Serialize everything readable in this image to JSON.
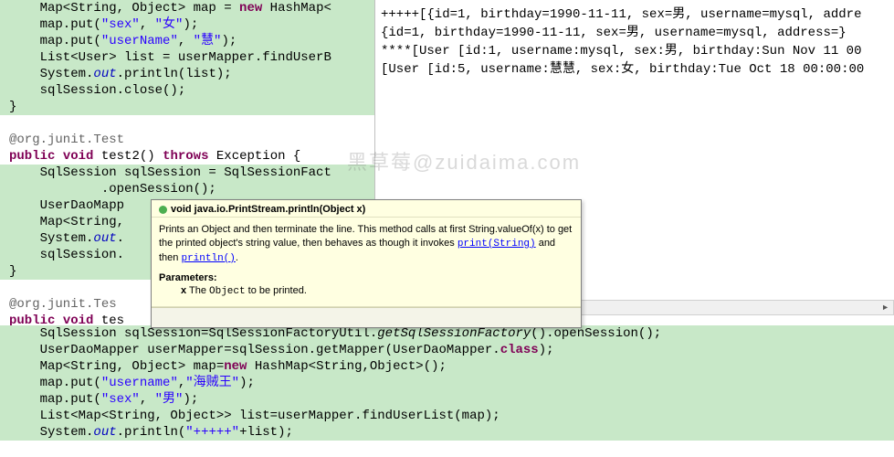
{
  "watermark": "黑草莓@zuidaima.com",
  "code": {
    "l01a": "    Map<String, Object> map = ",
    "l01b": "new",
    "l01c": " HashMap<",
    "l02a": "    map.put(",
    "l02b": "\"sex\"",
    "l02c": ", ",
    "l02d": "\"女\"",
    "l02e": ");",
    "l03a": "    map.put(",
    "l03b": "\"userName\"",
    "l03c": ", ",
    "l03d": "\"慧\"",
    "l03e": ");",
    "l04": "    List<User> list = userMapper.findUserB",
    "l05a": "    System.",
    "l05b": "out",
    "l05c": ".println(list);",
    "l06": "    sqlSession.close();",
    "l07": "}",
    "l08": "",
    "l09a": "@org.junit.Test",
    "l10a": "public",
    "l10b": " ",
    "l10c": "void",
    "l10d": " test2() ",
    "l10e": "throws",
    "l10f": " Exception {",
    "l11": "    SqlSession sqlSession = SqlSessionFact",
    "l12": "            .openSession();",
    "l13": "    UserDaoMapp",
    "l14": "    Map<String,",
    "l15a": "    System.",
    "l15b": "out",
    "l15c": ".",
    "l16": "    sqlSession.",
    "l17": "}",
    "l18": "",
    "l19a": "@org.junit.Tes",
    "l20a": "public",
    "l20b": " ",
    "l20c": "void",
    "l20d": " tes",
    "f01a": "    SqlSession sqlSession=SqlSessionFactoryUtil.",
    "f01b": "getSqlSessionFactory",
    "f01c": "().openSession();",
    "f02a": "    UserDaoMapper userMapper=sqlSession.getMapper(UserDaoMapper.",
    "f02b": "class",
    "f02c": ");",
    "f03a": "    Map<String, Object> map=",
    "f03b": "new",
    "f03c": " HashMap<String,Object>();",
    "f04a": "    map.put(",
    "f04b": "\"username\"",
    "f04c": ",",
    "f04d": "\"海贼王\"",
    "f04e": ");",
    "f05a": "    map.put(",
    "f05b": "\"sex\"",
    "f05c": ", ",
    "f05d": "\"男\"",
    "f05e": ");",
    "f06": "    List<Map<String, Object>> list=userMapper.findUserList(map);",
    "f07a": "    System.",
    "f07b": "out",
    "f07c": ".println(",
    "f07d": "\"+++++\"",
    "f07e": "+list);"
  },
  "console": {
    "l1": "+++++[{id=1, birthday=1990-11-11, sex=男, username=mysql, addre",
    "l2": "{id=1, birthday=1990-11-11, sex=男, username=mysql, address=}",
    "l3": "****[User [id:1, username:mysql, sex:男, birthday:Sun Nov 11 00",
    "l4": "[User [id:5, username:慧慧, sex:女, birthday:Tue Oct 18 00:00:00"
  },
  "tooltip": {
    "signature": "void java.io.PrintStream.println(Object x)",
    "desc1": "Prints an Object and then terminate the line. This method calls at first String.valueOf(x) to get the printed object's string value, then behaves as though it invokes ",
    "link1": "print(String)",
    "desc2": " and then ",
    "link2": "println()",
    "desc3": ".",
    "params_label": "Parameters:",
    "param_x_a": "x",
    "param_x_b": " The ",
    "param_x_c": "Object",
    "param_x_d": " to be printed."
  }
}
